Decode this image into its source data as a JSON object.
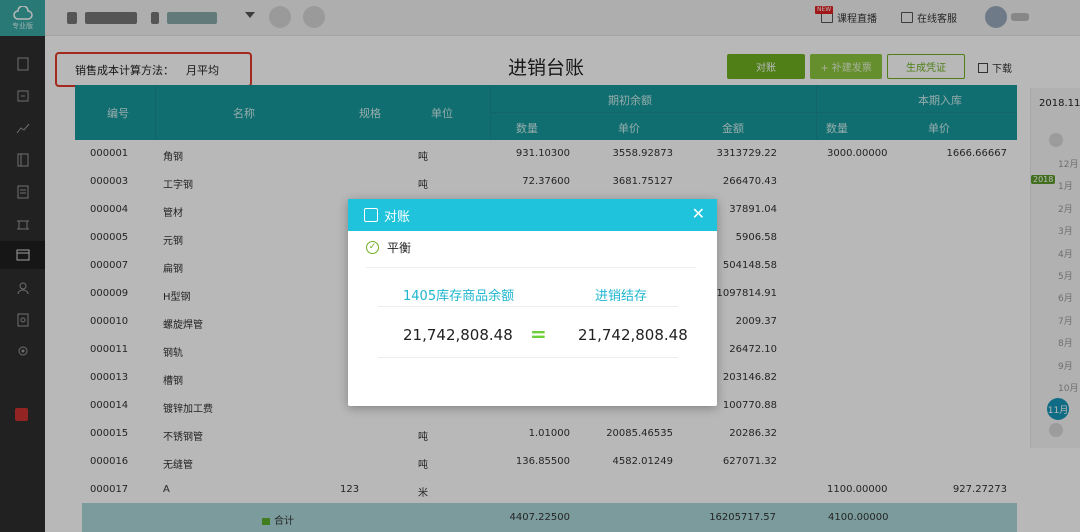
{
  "app": {
    "logo_label": "专业版"
  },
  "topbar": {
    "live_label": "课程直播",
    "new_tag": "NEW",
    "service_label": "在线客服"
  },
  "header": {
    "method_label": "销售成本计算方法：",
    "method_value": "月平均",
    "title": "进销台账",
    "btn_reconcile": "对账",
    "btn_second": "+ 补建发票",
    "btn_generate": "生成凭证",
    "download": "下载"
  },
  "table": {
    "headers": {
      "code": "编号",
      "name": "名称",
      "spec": "规格",
      "unit": "单位",
      "opening": "期初余额",
      "qty": "数量",
      "price": "单价",
      "amount": "金额",
      "inbound": "本期入库",
      "in_qty": "数量",
      "in_price": "单价"
    },
    "rows": [
      {
        "code": "000001",
        "name": "角钢",
        "spec": "",
        "unit": "吨",
        "qty": "931.10300",
        "price": "3558.92873",
        "amount": "3313729.22",
        "in_qty": "3000.00000",
        "in_price": "1666.66667"
      },
      {
        "code": "000003",
        "name": "工字钢",
        "spec": "",
        "unit": "吨",
        "qty": "72.37600",
        "price": "3681.75127",
        "amount": "266470.43",
        "in_qty": "",
        "in_price": ""
      },
      {
        "code": "000004",
        "name": "管材",
        "spec": "",
        "unit": "",
        "qty": "",
        "price": "",
        "amount": "37891.04",
        "in_qty": "",
        "in_price": ""
      },
      {
        "code": "000005",
        "name": "元钢",
        "spec": "",
        "unit": "",
        "qty": "",
        "price": "",
        "amount": "5906.58",
        "in_qty": "",
        "in_price": ""
      },
      {
        "code": "000007",
        "name": "扁钢",
        "spec": "",
        "unit": "",
        "qty": "",
        "price": "",
        "amount": "504148.58",
        "in_qty": "",
        "in_price": ""
      },
      {
        "code": "000009",
        "name": "H型钢",
        "spec": "",
        "unit": "",
        "qty": "",
        "price": "",
        "amount": "11097814.91",
        "in_qty": "",
        "in_price": ""
      },
      {
        "code": "000010",
        "name": "螺旋焊管",
        "spec": "",
        "unit": "",
        "qty": "",
        "price": "",
        "amount": "2009.37",
        "in_qty": "",
        "in_price": ""
      },
      {
        "code": "000011",
        "name": "钢轨",
        "spec": "",
        "unit": "",
        "qty": "",
        "price": "",
        "amount": "26472.10",
        "in_qty": "",
        "in_price": ""
      },
      {
        "code": "000013",
        "name": "槽钢",
        "spec": "",
        "unit": "",
        "qty": "",
        "price": "",
        "amount": "203146.82",
        "in_qty": "",
        "in_price": ""
      },
      {
        "code": "000014",
        "name": "镀锌加工费",
        "spec": "",
        "unit": "",
        "qty": "",
        "price": "",
        "amount": "100770.88",
        "in_qty": "",
        "in_price": ""
      },
      {
        "code": "000015",
        "name": "不锈钢管",
        "spec": "",
        "unit": "吨",
        "qty": "1.01000",
        "price": "20085.46535",
        "amount": "20286.32",
        "in_qty": "",
        "in_price": ""
      },
      {
        "code": "000016",
        "name": "无缝管",
        "spec": "",
        "unit": "吨",
        "qty": "136.85500",
        "price": "4582.01249",
        "amount": "627071.32",
        "in_qty": "",
        "in_price": ""
      },
      {
        "code": "000017",
        "name": "A",
        "spec": "123",
        "unit": "米",
        "qty": "",
        "price": "",
        "amount": "",
        "in_qty": "1100.00000",
        "in_price": "927.27273"
      }
    ],
    "total": {
      "label": "合计",
      "qty": "4407.22500",
      "amount": "16205717.57",
      "in_qty": "4100.00000"
    }
  },
  "timeline": {
    "year": "2018.11",
    "badge": "2018",
    "months": [
      "12月",
      "1月",
      "2月",
      "3月",
      "4月",
      "5月",
      "6月",
      "7月",
      "8月",
      "9月",
      "10月"
    ],
    "active": "11月"
  },
  "modal": {
    "title": "对账",
    "status": "平衡",
    "left_label": "1405库存商品余额",
    "right_label": "进销结存",
    "left_value": "21,742,808.48",
    "right_value": "21,742,808.48",
    "equals": "="
  },
  "colors": {
    "teal": "#17999b",
    "green": "#6fb122",
    "modal_accent": "#1fc3db",
    "highlight_red": "#e23a2a"
  }
}
